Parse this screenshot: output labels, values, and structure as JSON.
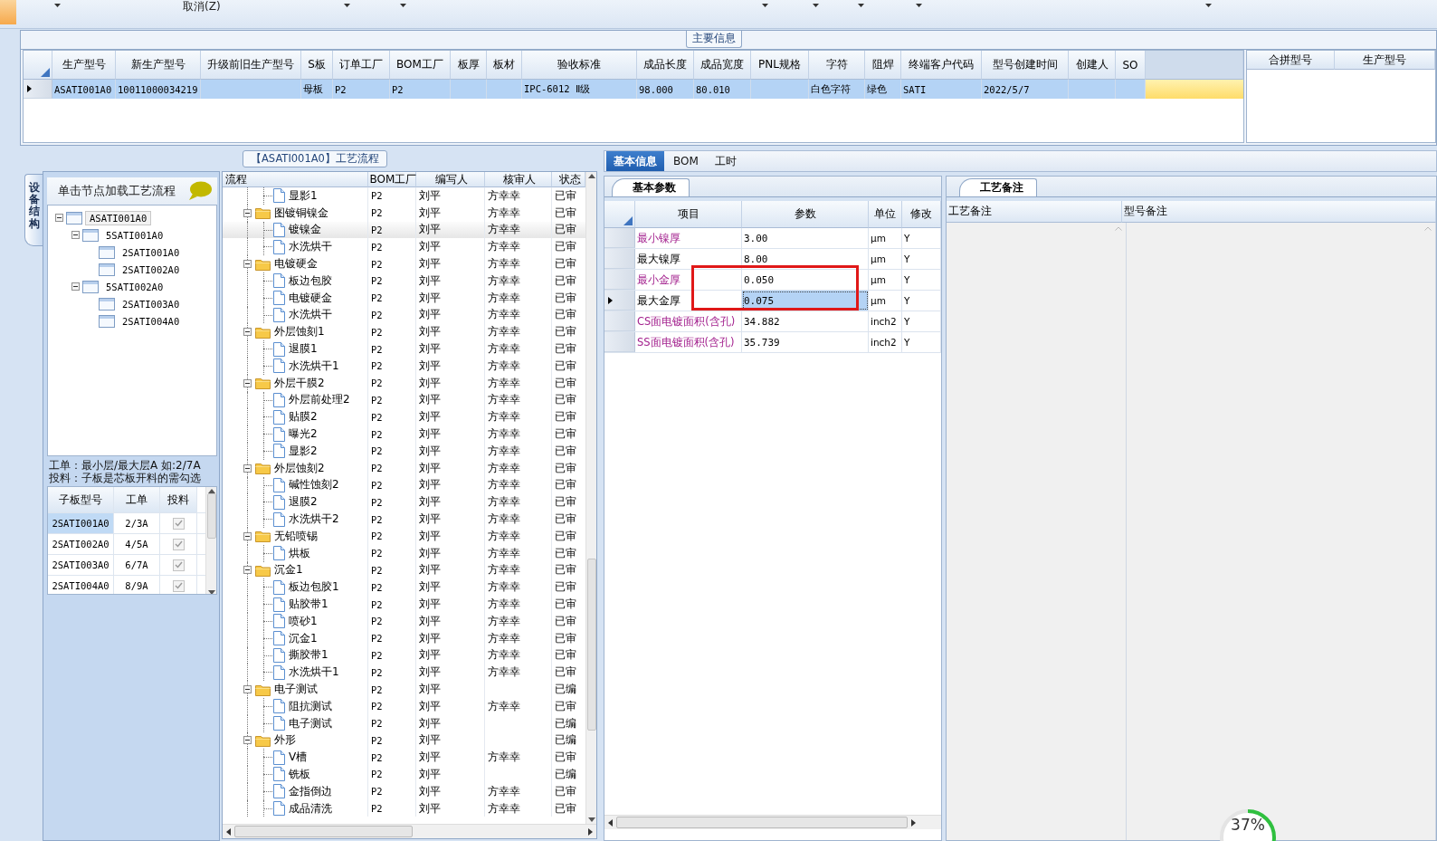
{
  "toolbar": {
    "cancel_label": "取消(Z)"
  },
  "main_info": {
    "title": "主要信息",
    "row_selected": true,
    "columns": [
      {
        "label": "生产型号",
        "value": "ASATI001A0"
      },
      {
        "label": "新生产型号",
        "value": "10011000034219"
      },
      {
        "label": "升级前旧生产型号"
      },
      {
        "label": "S板",
        "value": "母板"
      },
      {
        "label": "订单工厂",
        "value": "P2"
      },
      {
        "label": "BOM工厂",
        "value": "P2"
      },
      {
        "label": "板厚"
      },
      {
        "label": "板材"
      },
      {
        "label": "验收标准",
        "value": "IPC-6012 Ⅱ级"
      },
      {
        "label": "成品长度",
        "value": "98.000"
      },
      {
        "label": "成品宽度",
        "value": "80.010"
      },
      {
        "label": "PNL规格"
      },
      {
        "label": "字符",
        "value": "白色字符"
      },
      {
        "label": "阻焊",
        "value": "绿色"
      },
      {
        "label": "终端客户代码",
        "value": "SATI"
      },
      {
        "label": "型号创建时间",
        "value": "2022/5/7"
      },
      {
        "label": "创建人"
      },
      {
        "label": "SO"
      }
    ],
    "merge_columns": [
      "合拼型号",
      "生产型号"
    ]
  },
  "structure": {
    "tab_label": "设备结构",
    "hint": "单击节点加载工艺流程",
    "tree": [
      {
        "label": "ASATI001A0",
        "selected": true,
        "expanded": true,
        "children": [
          {
            "label": "5SATI001A0",
            "selected": false,
            "expanded": true,
            "children": [
              {
                "label": "2SATI001A0",
                "selected": false
              },
              {
                "label": "2SATI002A0",
                "selected": false
              }
            ]
          },
          {
            "label": "5SATI002A0",
            "selected": false,
            "expanded": true,
            "children": [
              {
                "label": "2SATI003A0",
                "selected": false
              },
              {
                "label": "2SATI004A0",
                "selected": false
              }
            ]
          }
        ]
      }
    ],
    "note_lines": [
      "工单：最小层/最大层A 如:2/7A",
      "投料：子板是芯板开料的需勾选"
    ],
    "grid_columns": [
      "子板型号",
      "工单",
      "投料"
    ],
    "grid_rows": [
      {
        "board": "2SATI001A0",
        "order": "2/3A",
        "checked": true,
        "selected": true
      },
      {
        "board": "2SATI002A0",
        "order": "4/5A",
        "checked": true,
        "selected": false
      },
      {
        "board": "2SATI003A0",
        "order": "6/7A",
        "checked": true,
        "selected": false
      },
      {
        "board": "2SATI004A0",
        "order": "8/9A",
        "checked": true,
        "selected": false
      }
    ]
  },
  "flow": {
    "title": "【ASATI001A0】工艺流程",
    "columns": [
      "流程",
      "BOM工厂",
      "编写人",
      "核审人",
      "状态"
    ],
    "rows": [
      {
        "kind": "step",
        "name": "显影1",
        "factory": "P2",
        "writer": "刘平",
        "reviewer": "方幸幸",
        "status": "已审",
        "selected": false
      },
      {
        "kind": "group",
        "name": "图镀铜镍金",
        "factory": "P2",
        "writer": "刘平",
        "reviewer": "方幸幸",
        "status": "已审",
        "selected": false,
        "expanded": true,
        "children": [
          {
            "kind": "step",
            "name": "镀镍金",
            "factory": "P2",
            "writer": "刘平",
            "reviewer": "方幸幸",
            "status": "已审",
            "selected": true
          },
          {
            "kind": "step",
            "name": "水洗烘干",
            "factory": "P2",
            "writer": "刘平",
            "reviewer": "方幸幸",
            "status": "已审",
            "selected": false
          }
        ]
      },
      {
        "kind": "group",
        "name": "电镀硬金",
        "factory": "P2",
        "writer": "刘平",
        "reviewer": "方幸幸",
        "status": "已审",
        "selected": false,
        "expanded": true,
        "children": [
          {
            "kind": "step",
            "name": "板边包胶",
            "factory": "P2",
            "writer": "刘平",
            "reviewer": "方幸幸",
            "status": "已审",
            "selected": false
          },
          {
            "kind": "step",
            "name": "电镀硬金",
            "factory": "P2",
            "writer": "刘平",
            "reviewer": "方幸幸",
            "status": "已审",
            "selected": false
          },
          {
            "kind": "step",
            "name": "水洗烘干",
            "factory": "P2",
            "writer": "刘平",
            "reviewer": "方幸幸",
            "status": "已审",
            "selected": false
          }
        ]
      },
      {
        "kind": "group",
        "name": "外层蚀刻1",
        "factory": "P2",
        "writer": "刘平",
        "reviewer": "方幸幸",
        "status": "已审",
        "selected": false,
        "expanded": true,
        "children": [
          {
            "kind": "step",
            "name": "退膜1",
            "factory": "P2",
            "writer": "刘平",
            "reviewer": "方幸幸",
            "status": "已审",
            "selected": false
          },
          {
            "kind": "step",
            "name": "水洗烘干1",
            "factory": "P2",
            "writer": "刘平",
            "reviewer": "方幸幸",
            "status": "已审",
            "selected": false
          }
        ]
      },
      {
        "kind": "group",
        "name": "外层干膜2",
        "factory": "P2",
        "writer": "刘平",
        "reviewer": "方幸幸",
        "status": "已审",
        "selected": false,
        "expanded": true,
        "children": [
          {
            "kind": "step",
            "name": "外层前处理2",
            "factory": "P2",
            "writer": "刘平",
            "reviewer": "方幸幸",
            "status": "已审",
            "selected": false
          },
          {
            "kind": "step",
            "name": "贴膜2",
            "factory": "P2",
            "writer": "刘平",
            "reviewer": "方幸幸",
            "status": "已审",
            "selected": false
          },
          {
            "kind": "step",
            "name": "曝光2",
            "factory": "P2",
            "writer": "刘平",
            "reviewer": "方幸幸",
            "status": "已审",
            "selected": false
          },
          {
            "kind": "step",
            "name": "显影2",
            "factory": "P2",
            "writer": "刘平",
            "reviewer": "方幸幸",
            "status": "已审",
            "selected": false
          }
        ]
      },
      {
        "kind": "group",
        "name": "外层蚀刻2",
        "factory": "P2",
        "writer": "刘平",
        "reviewer": "方幸幸",
        "status": "已审",
        "selected": false,
        "expanded": true,
        "children": [
          {
            "kind": "step",
            "name": "碱性蚀刻2",
            "factory": "P2",
            "writer": "刘平",
            "reviewer": "方幸幸",
            "status": "已审",
            "selected": false
          },
          {
            "kind": "step",
            "name": "退膜2",
            "factory": "P2",
            "writer": "刘平",
            "reviewer": "方幸幸",
            "status": "已审",
            "selected": false
          },
          {
            "kind": "step",
            "name": "水洗烘干2",
            "factory": "P2",
            "writer": "刘平",
            "reviewer": "方幸幸",
            "status": "已审",
            "selected": false
          }
        ]
      },
      {
        "kind": "group",
        "name": "无铅喷锡",
        "factory": "P2",
        "writer": "刘平",
        "reviewer": "方幸幸",
        "status": "已审",
        "selected": false,
        "expanded": true,
        "children": [
          {
            "kind": "step",
            "name": "烘板",
            "factory": "P2",
            "writer": "刘平",
            "reviewer": "方幸幸",
            "status": "已审",
            "selected": false
          }
        ]
      },
      {
        "kind": "group",
        "name": "沉金1",
        "factory": "P2",
        "writer": "刘平",
        "reviewer": "方幸幸",
        "status": "已审",
        "selected": false,
        "expanded": true,
        "children": [
          {
            "kind": "step",
            "name": "板边包胶1",
            "factory": "P2",
            "writer": "刘平",
            "reviewer": "方幸幸",
            "status": "已审",
            "selected": false
          },
          {
            "kind": "step",
            "name": "贴胶带1",
            "factory": "P2",
            "writer": "刘平",
            "reviewer": "方幸幸",
            "status": "已审",
            "selected": false
          },
          {
            "kind": "step",
            "name": "喷砂1",
            "factory": "P2",
            "writer": "刘平",
            "reviewer": "方幸幸",
            "status": "已审",
            "selected": false
          },
          {
            "kind": "step",
            "name": "沉金1",
            "factory": "P2",
            "writer": "刘平",
            "reviewer": "方幸幸",
            "status": "已审",
            "selected": false
          },
          {
            "kind": "step",
            "name": "撕胶带1",
            "factory": "P2",
            "writer": "刘平",
            "reviewer": "方幸幸",
            "status": "已审",
            "selected": false
          },
          {
            "kind": "step",
            "name": "水洗烘干1",
            "factory": "P2",
            "writer": "刘平",
            "reviewer": "方幸幸",
            "status": "已审",
            "selected": false
          }
        ]
      },
      {
        "kind": "group",
        "name": "电子测试",
        "factory": "P2",
        "writer": "刘平",
        "status": "已编",
        "selected": false,
        "expanded": true,
        "children": [
          {
            "kind": "step",
            "name": "阻抗测试",
            "factory": "P2",
            "writer": "刘平",
            "reviewer": "方幸幸",
            "status": "已审",
            "selected": false
          },
          {
            "kind": "step",
            "name": "电子测试",
            "factory": "P2",
            "writer": "刘平",
            "status": "已编",
            "selected": false
          }
        ]
      },
      {
        "kind": "group",
        "name": "外形",
        "factory": "P2",
        "writer": "刘平",
        "status": "已编",
        "selected": false,
        "expanded": true,
        "children": [
          {
            "kind": "step",
            "name": "V槽",
            "factory": "P2",
            "writer": "刘平",
            "reviewer": "方幸幸",
            "status": "已审",
            "selected": false
          },
          {
            "kind": "step",
            "name": "铣板",
            "factory": "P2",
            "writer": "刘平",
            "status": "已编",
            "selected": false
          },
          {
            "kind": "step",
            "name": "金指倒边",
            "factory": "P2",
            "writer": "刘平",
            "reviewer": "方幸幸",
            "status": "已审",
            "selected": false
          },
          {
            "kind": "step",
            "name": "成品清洗",
            "factory": "P2",
            "writer": "刘平",
            "reviewer": "方幸幸",
            "status": "已审",
            "selected": false
          }
        ]
      }
    ]
  },
  "detail": {
    "tabs": [
      {
        "label": "基本信息",
        "selected": true
      },
      {
        "label": "BOM",
        "selected": false
      },
      {
        "label": "工时",
        "selected": false
      }
    ],
    "params_tab": "基本参数",
    "param_columns": [
      "项目",
      "参数",
      "单位",
      "修改"
    ],
    "params": [
      {
        "item": "最小镍厚",
        "value": "3.00",
        "unit": "μm",
        "edit": "Y",
        "emphasized": true,
        "current": false,
        "highlighted": false
      },
      {
        "item": "最大镍厚",
        "value": "8.00",
        "unit": "μm",
        "edit": "Y",
        "emphasized": false,
        "current": false,
        "highlighted": false
      },
      {
        "item": "最小金厚",
        "value": "0.050",
        "unit": "μm",
        "edit": "Y",
        "emphasized": true,
        "current": false,
        "highlighted": true
      },
      {
        "item": "最大金厚",
        "value": "0.075",
        "unit": "μm",
        "edit": "Y",
        "emphasized": false,
        "current": true,
        "highlighted": true
      },
      {
        "item": "CS面电镀面积(含孔)",
        "value": "34.882",
        "unit": "inch2",
        "edit": "Y",
        "emphasized": true,
        "current": false,
        "highlighted": false
      },
      {
        "item": "SS面电镀面积(含孔)",
        "value": "35.739",
        "unit": "inch2",
        "edit": "Y",
        "emphasized": true,
        "current": false,
        "highlighted": false
      }
    ],
    "notes_tab": "工艺备注",
    "note_columns": [
      "工艺备注",
      "型号备注"
    ]
  },
  "progress": {
    "reading": "37%",
    "level": 0.37
  }
}
